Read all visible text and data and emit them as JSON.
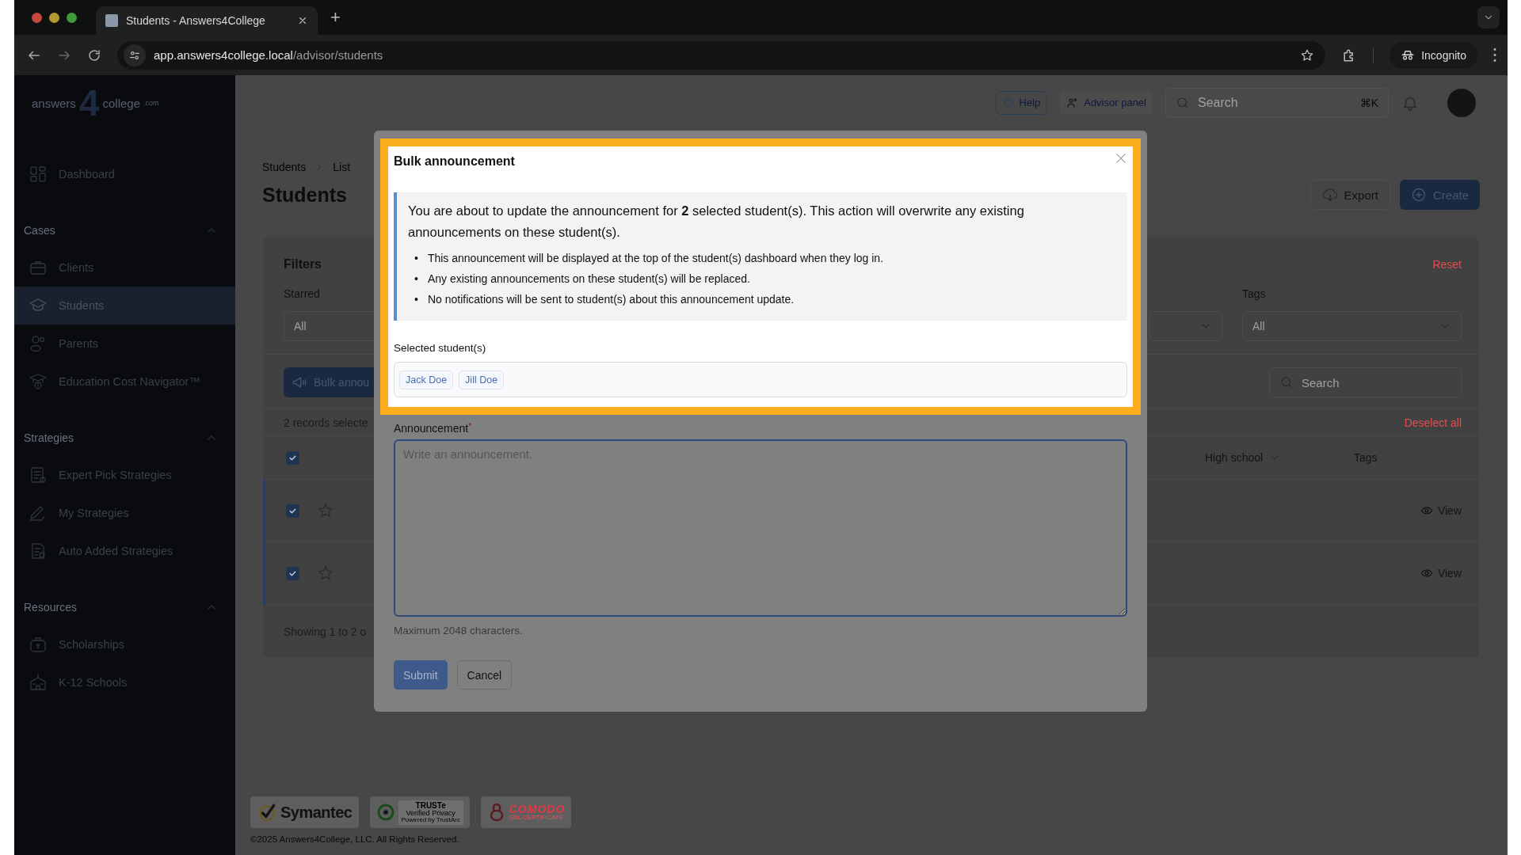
{
  "browser": {
    "tabs": [
      {
        "title": "Students - Answers4College",
        "selected": true
      }
    ],
    "new_tab": "+",
    "url_host": "app.answers4college.local",
    "url_path": "/advisor/students",
    "profile": "Incognito"
  },
  "sidebar": {
    "logo": {
      "word": "answers",
      "numeral": "4",
      "word2": "college",
      "suffix": ".com"
    },
    "items": [
      {
        "label": "Dashboard",
        "selected": false
      }
    ],
    "sections": [
      {
        "title": "Cases",
        "expanded": true,
        "items": [
          {
            "label": "Clients",
            "selected": false
          },
          {
            "label": "Students",
            "selected": true
          },
          {
            "label": "Parents",
            "selected": false
          },
          {
            "label": "Education Cost Navigator™",
            "selected": false
          }
        ]
      },
      {
        "title": "Strategies",
        "expanded": true,
        "items": [
          {
            "label": "Expert Pick Strategies",
            "selected": false
          },
          {
            "label": "My Strategies",
            "selected": false
          },
          {
            "label": "Auto Added Strategies",
            "selected": false
          }
        ]
      },
      {
        "title": "Resources",
        "expanded": true,
        "items": [
          {
            "label": "Scholarships",
            "selected": false
          },
          {
            "label": "K-12 Schools",
            "selected": false
          }
        ]
      }
    ]
  },
  "topbar": {
    "help": "Help",
    "advisor_panel": "Advisor panel",
    "search": {
      "placeholder": "Search",
      "shortcut": "⌘K"
    }
  },
  "page": {
    "breadcrumb": [
      "Students",
      "List"
    ],
    "title": "Students",
    "actions": [
      {
        "label": "Export",
        "kind": "secondary"
      },
      {
        "label": "Create",
        "kind": "primary"
      }
    ],
    "filters": {
      "title": "Filters",
      "reset": "Reset",
      "fields": [
        {
          "label": "Starred",
          "value": "All"
        },
        {
          "label": "Tags",
          "value": "All"
        }
      ]
    },
    "bulk_button": "Bulk annou",
    "search": {
      "placeholder": "Search"
    },
    "selection_text": "2 records selecte",
    "deselect_all": "Deselect all",
    "table": {
      "select_all_checked": true,
      "columns": [
        {
          "label": "High school",
          "sortable": true
        },
        {
          "label": "Tags",
          "sortable": false
        }
      ],
      "rows": [
        {
          "checked": true,
          "starred": false,
          "action": "View"
        },
        {
          "checked": true,
          "starred": false,
          "action": "View"
        }
      ]
    },
    "footer_text": "Showing 1 to 2 o"
  },
  "footer": {
    "badges": [
      {
        "kind": "symantec",
        "texts": [
          "Symantec"
        ]
      },
      {
        "kind": "truste",
        "texts": [
          "TRUSTe",
          "Verified Privacy",
          "Powered by TrustArc"
        ]
      },
      {
        "kind": "comodo",
        "texts": [
          "COMODO",
          "SSL CERTIFICATE"
        ]
      }
    ],
    "copyright": "©2025 Answers4College, LLC. All Rights Reserved."
  },
  "modal": {
    "title": "Bulk announcement",
    "highlighted": true,
    "intro": "You are about to update the announcement for **2** selected student(s). This action will overwrite any existing announcements on these student(s).",
    "bullets": [
      "This announcement will be displayed at the top of the student(s) dashboard when they log in.",
      "Any existing announcements on these student(s) will be replaced.",
      "No notifications will be sent to student(s) about this announcement update."
    ],
    "bullet": "•",
    "selected_label": "Selected student(s)",
    "students": [
      "Jack Doe",
      "Jill Doe"
    ],
    "announcement": {
      "label": "Announcement",
      "required_mark": "*",
      "placeholder": "Write an announcement.",
      "hint": "Maximum 2048 characters."
    },
    "buttons": [
      {
        "label": "Submit",
        "kind": "primary"
      },
      {
        "label": "Cancel",
        "kind": "secondary"
      }
    ]
  }
}
